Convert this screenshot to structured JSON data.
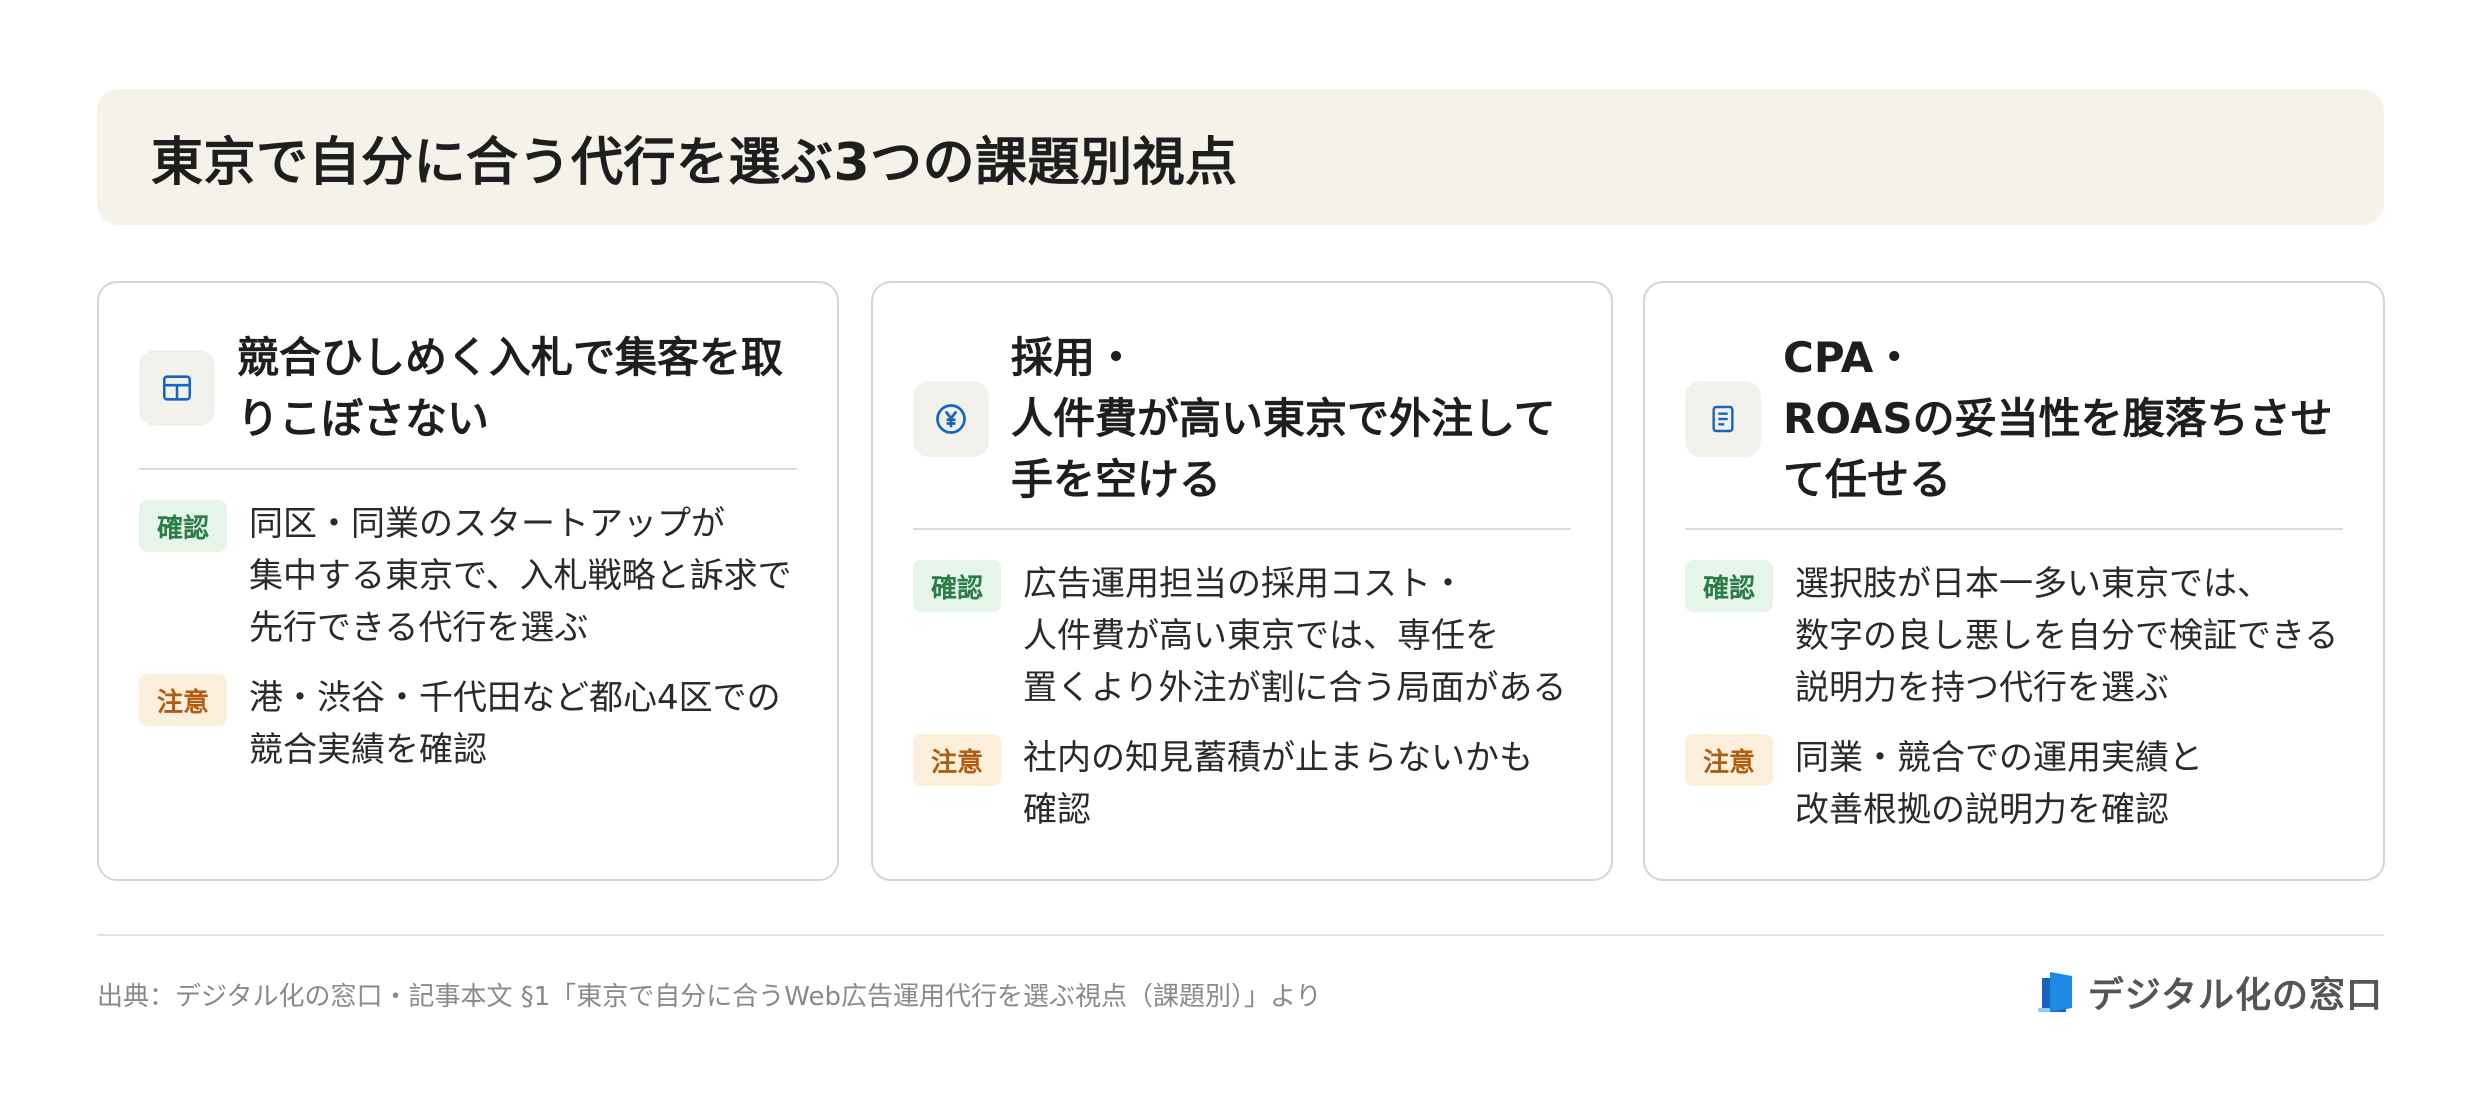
{
  "header": {
    "title": "東京で自分に合う代行を選ぶ3つの課題別視点"
  },
  "cards": [
    {
      "icon": "table-icon",
      "title": "競合ひしめく入札で集客を取\nりこぼさない",
      "items": [
        {
          "badge": "確認",
          "text": "同区・同業のスタートアップが\n集中する東京で、入札戦略と訴求で\n先行できる代行を選ぶ"
        },
        {
          "badge": "注意",
          "text": "港・渋谷・千代田など都心4区での\n競合実績を確認"
        }
      ]
    },
    {
      "icon": "yen-icon",
      "title": "採用・\n人件費が高い東京で外注して\n手を空ける",
      "items": [
        {
          "badge": "確認",
          "text": "広告運用担当の採用コスト・\n人件費が高い東京では、専任を\n置くより外注が割に合う局面がある"
        },
        {
          "badge": "注意",
          "text": "社内の知見蓄積が止まらないかも\n確認"
        }
      ]
    },
    {
      "icon": "document-icon",
      "title": "CPA・\nROASの妥当性を腹落ちさせ\nて任せる",
      "items": [
        {
          "badge": "確認",
          "text": "選択肢が日本一多い東京では、\n数字の良し悪しを自分で検証できる\n説明力を持つ代行を選ぶ"
        },
        {
          "badge": "注意",
          "text": "同業・競合での運用実績と\n改善根拠の説明力を確認"
        }
      ]
    }
  ],
  "footer": {
    "source": "出典：デジタル化の窓口・記事本文 §1「東京で自分に合うWeb広告運用代行を選ぶ視点（課題別）」より",
    "brand": "デジタル化の窓口"
  },
  "colors": {
    "accent": "#1565c0",
    "confirm": "#2a7d46",
    "caution": "#b05d13"
  }
}
